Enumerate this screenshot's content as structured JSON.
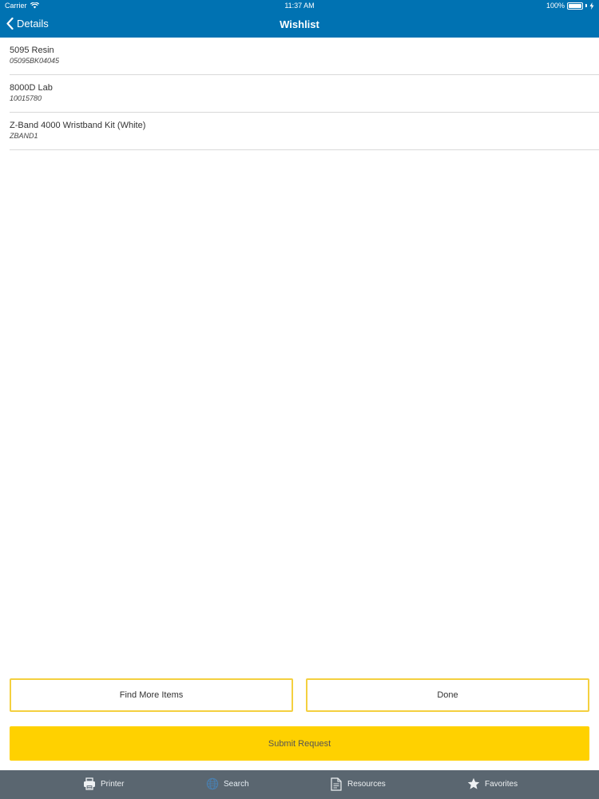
{
  "status_bar": {
    "carrier": "Carrier",
    "time": "11:37 AM",
    "battery": "100%",
    "battery_level": 1.0
  },
  "nav": {
    "back_label": "Details",
    "title": "Wishlist"
  },
  "wishlist": {
    "items": [
      {
        "name": "5095 Resin",
        "code": "05095BK04045"
      },
      {
        "name": "8000D Lab",
        "code": "10015780"
      },
      {
        "name": "Z-Band 4000 Wristband Kit (White)",
        "code": "ZBAND1"
      }
    ]
  },
  "actions": {
    "find_more_label": "Find More Items",
    "done_label": "Done",
    "submit_label": "Submit Request"
  },
  "tabbar": {
    "active": "search",
    "tabs": [
      {
        "id": "printer",
        "label": "Printer",
        "icon": "printer-icon"
      },
      {
        "id": "search",
        "label": "Search",
        "icon": "globe-icon"
      },
      {
        "id": "resources",
        "label": "Resources",
        "icon": "document-icon"
      },
      {
        "id": "favorites",
        "label": "Favorites",
        "icon": "star-icon"
      }
    ]
  },
  "colors": {
    "nav_blue": "#0072b2",
    "accent_yellow": "#ffd100",
    "outline_yellow": "#f4d03f",
    "tabbar_gray": "#5a6670"
  }
}
